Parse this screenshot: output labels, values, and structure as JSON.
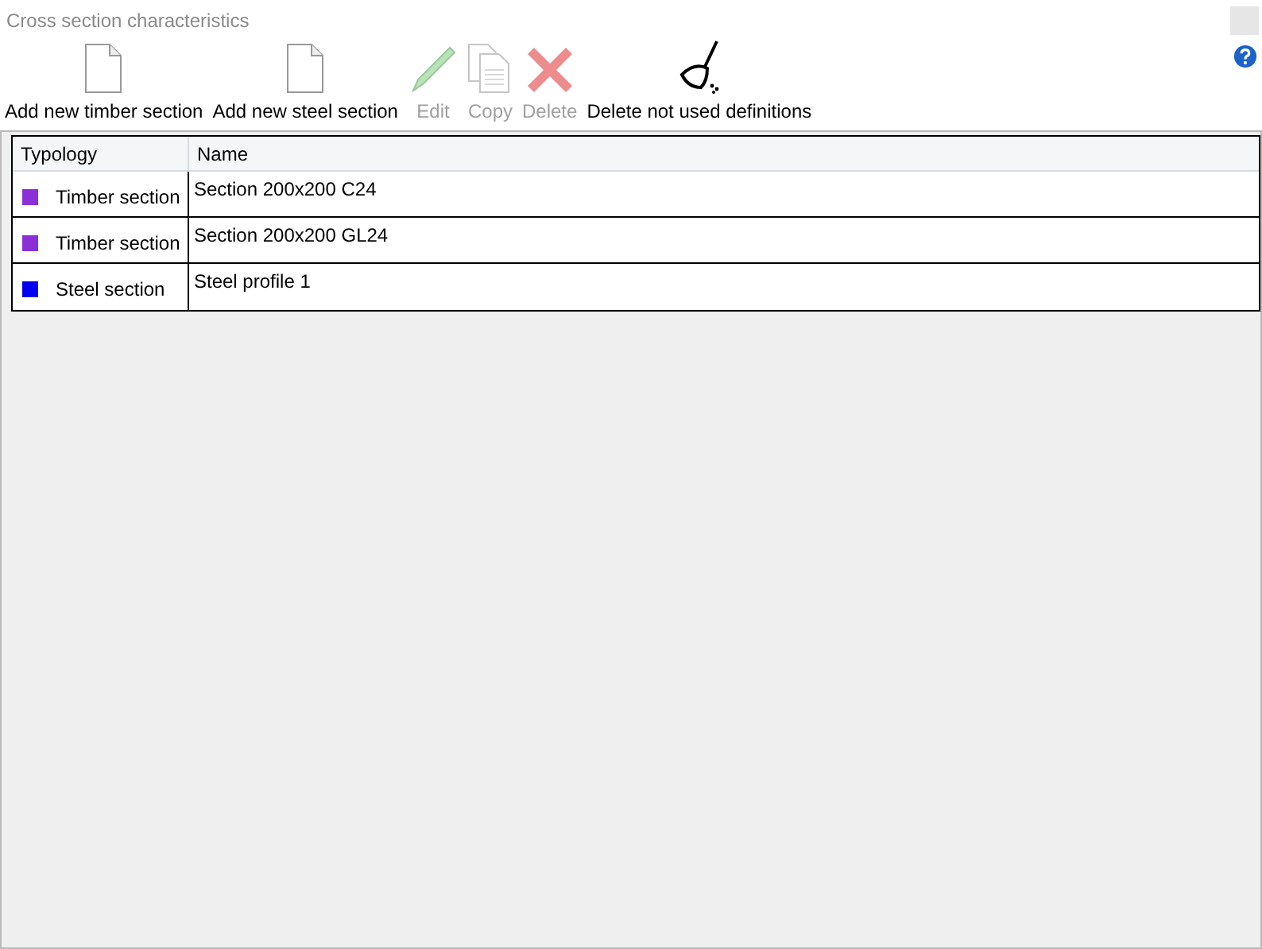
{
  "window": {
    "title": "Cross section characteristics"
  },
  "toolbar": [
    {
      "label": "Add new timber section",
      "kind": "document",
      "disabled": false
    },
    {
      "label": "Add new steel section",
      "kind": "document",
      "disabled": false
    },
    {
      "label": "Edit",
      "kind": "pencil",
      "disabled": true
    },
    {
      "label": "Copy",
      "kind": "copy",
      "disabled": true
    },
    {
      "label": "Delete",
      "kind": "delete",
      "disabled": true
    },
    {
      "label": "Delete not used definitions",
      "kind": "broom",
      "disabled": false
    }
  ],
  "table": {
    "columns": [
      "Typology",
      "Name"
    ],
    "rows": [
      {
        "typology": "Timber section",
        "color": "#8b2fd6",
        "name": "Section 200x200 C24"
      },
      {
        "typology": "Timber section",
        "color": "#8b2fd6",
        "name": "Section 200x200 GL24"
      },
      {
        "typology": "Steel section",
        "color": "#0000ee",
        "name": "Steel profile 1"
      }
    ]
  }
}
